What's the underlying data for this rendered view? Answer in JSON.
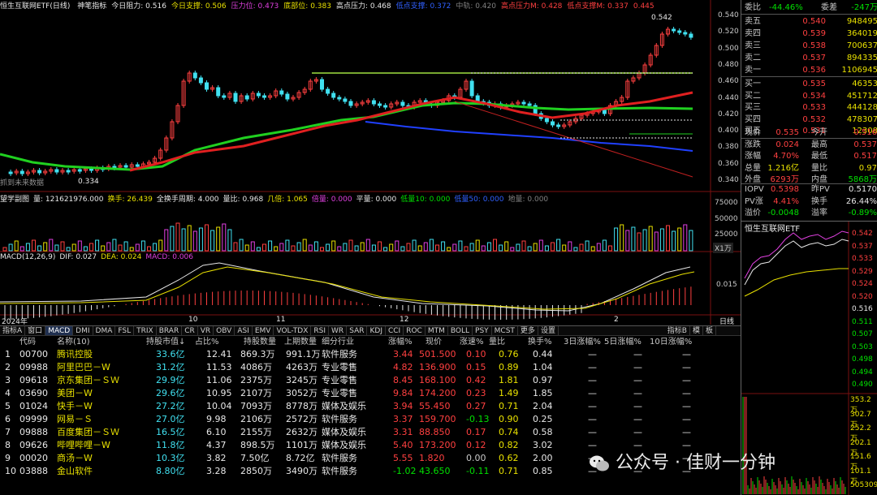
{
  "header": {
    "title": "恒生互联网ETF(日线)",
    "items": [
      {
        "label": "神笔指标",
        "color": "#e8e8e8"
      },
      {
        "label": "今日阻力: 0.516",
        "color": "#e8e8e8"
      },
      {
        "label": "今日支撑: 0.506",
        "color": "#e8e000"
      },
      {
        "label": "压力位: 0.473",
        "color": "#e040e0"
      },
      {
        "label": "底部位: 0.383",
        "color": "#e8e000"
      },
      {
        "label": "高点压力: 0.468",
        "color": "#e8e8e8"
      },
      {
        "label": "低点支撑: 0.372",
        "color": "#3060ff"
      },
      {
        "label": "中轨: 0.420",
        "color": "#808080"
      },
      {
        "label": "高点压力M: 0.428",
        "color": "#ff4040"
      },
      {
        "label": "低点支撑M: 0.337",
        "color": "#ff4040"
      },
      {
        "label": "0.445",
        "color": "#ff4040"
      }
    ]
  },
  "price_axis": [
    "0.540",
    "0.520",
    "0.500",
    "0.480",
    "0.460",
    "0.440",
    "0.420",
    "0.400",
    "0.380",
    "0.360",
    "0.340"
  ],
  "annotations": {
    "high": "0.542",
    "low": "0.334",
    "watermark_note": "抓到未来数据"
  },
  "volume_bar": {
    "items": [
      {
        "label": "望学副图",
        "color": "#e8e8e8"
      },
      {
        "label": "量: 121621976.000",
        "color": "#e8e8e8"
      },
      {
        "label": "换手: 26.439",
        "color": "#e8e000"
      },
      {
        "label": "全换手周期: 4.000",
        "color": "#e8e8e8"
      },
      {
        "label": "量比: 0.968",
        "color": "#e8e8e8"
      },
      {
        "label": "几倍: 1.065",
        "color": "#e8e000"
      },
      {
        "label": "倍量: 0.000",
        "color": "#e040e0"
      },
      {
        "label": "平量: 0.000",
        "color": "#e8e8e8"
      },
      {
        "label": "低量10: 0.000",
        "color": "#00e000"
      },
      {
        "label": "低量50: 0.000",
        "color": "#3060ff"
      },
      {
        "label": "地量: 0.000",
        "color": "#808080"
      }
    ],
    "axis": [
      "75000",
      "50000",
      "25000"
    ],
    "unit": "X1万"
  },
  "macd_bar": {
    "items": [
      {
        "label": "MACD(12,26,9)",
        "color": "#e8e8e8"
      },
      {
        "label": "DIF: 0.027",
        "color": "#e8e8e8"
      },
      {
        "label": "DEA: 0.024",
        "color": "#e8e000"
      },
      {
        "label": "MACD: 0.006",
        "color": "#e040e0"
      }
    ],
    "axis": [
      "0.015"
    ]
  },
  "dates": [
    {
      "label": "2024年",
      "color": "#e8e8e8"
    },
    {
      "label": "10",
      "color": "#e8e8e8"
    },
    {
      "label": "11",
      "color": "#e8e8e8"
    },
    {
      "label": "12",
      "color": "#e8e8e8"
    },
    {
      "label": "2",
      "color": "#e8e8e8"
    }
  ],
  "corner_label": "日线",
  "tabs": [
    "指标A",
    "窗口",
    "MACD",
    "DMI",
    "DMA",
    "FSL",
    "TRIX",
    "BRAR",
    "CR",
    "VR",
    "OBV",
    "ASI",
    "EMV",
    "VOL-TDX",
    "RSI",
    "WR",
    "SAR",
    "KDJ",
    "CCI",
    "ROC",
    "MTM",
    "BOLL",
    "PSY",
    "MCST",
    "更多",
    "设置"
  ],
  "tabs_right": [
    "指标B",
    "模",
    "板"
  ],
  "table": {
    "headers": [
      "代码",
      "名称(10)",
      "持股市值↓",
      "占比%",
      "持股数量",
      "上期数量",
      "细分行业",
      "涨幅%",
      "现价",
      "涨速%",
      "量比",
      "换手%",
      "3日涨幅%",
      "5日涨幅%",
      "10日涨幅%"
    ],
    "rows": [
      {
        "n": "1",
        "code": "00700",
        "name": "腾讯控股",
        "mv": "33.6亿",
        "pct": "12.41",
        "qty": "869.3万",
        "prev": "991.1万",
        "ind": "软件服务",
        "chg": "3.44",
        "px": "501.500",
        "spd": "0.10",
        "vr": "0.76",
        "to": "0.44",
        "d3": "—",
        "d5": "—",
        "d10": "—",
        "chgc": "#ff4040",
        "spdc": "#ff4040"
      },
      {
        "n": "2",
        "code": "09988",
        "name": "阿里巴巴－W",
        "mv": "31.2亿",
        "pct": "11.53",
        "qty": "4086万",
        "prev": "4263万",
        "ind": "专业零售",
        "chg": "4.82",
        "px": "136.900",
        "spd": "0.15",
        "vr": "0.89",
        "to": "1.04",
        "d3": "—",
        "d5": "—",
        "d10": "—",
        "chgc": "#ff4040",
        "spdc": "#ff4040"
      },
      {
        "n": "3",
        "code": "09618",
        "name": "京东集团－ＳＷ",
        "mv": "29.9亿",
        "pct": "11.06",
        "qty": "2375万",
        "prev": "3245万",
        "ind": "专业零售",
        "chg": "8.45",
        "px": "168.100",
        "spd": "0.42",
        "vr": "1.81",
        "to": "0.97",
        "d3": "—",
        "d5": "—",
        "d10": "—",
        "chgc": "#ff4040",
        "spdc": "#ff4040"
      },
      {
        "n": "4",
        "code": "03690",
        "name": "美团－W",
        "mv": "29.6亿",
        "pct": "10.95",
        "qty": "2107万",
        "prev": "3052万",
        "ind": "专业零售",
        "chg": "9.84",
        "px": "174.200",
        "spd": "0.23",
        "vr": "1.49",
        "to": "1.85",
        "d3": "—",
        "d5": "—",
        "d10": "—",
        "chgc": "#ff4040",
        "spdc": "#ff4040"
      },
      {
        "n": "5",
        "code": "01024",
        "name": "快手－W",
        "mv": "27.2亿",
        "pct": "10.04",
        "qty": "7093万",
        "prev": "8778万",
        "ind": "媒体及娱乐",
        "chg": "3.94",
        "px": "55.450",
        "spd": "0.27",
        "vr": "0.71",
        "to": "2.04",
        "d3": "—",
        "d5": "—",
        "d10": "—",
        "chgc": "#ff4040",
        "spdc": "#ff4040"
      },
      {
        "n": "6",
        "code": "09999",
        "name": "网易－Ｓ",
        "mv": "27.0亿",
        "pct": "9.98",
        "qty": "2106万",
        "prev": "2572万",
        "ind": "软件服务",
        "chg": "3.37",
        "px": "159.700",
        "spd": "-0.13",
        "vr": "0.90",
        "to": "0.25",
        "d3": "—",
        "d5": "—",
        "d10": "—",
        "chgc": "#ff4040",
        "spdc": "#00e000"
      },
      {
        "n": "7",
        "code": "09888",
        "name": "百度集团－ＳＷ",
        "mv": "16.5亿",
        "pct": "6.10",
        "qty": "2155万",
        "prev": "2632万",
        "ind": "媒体及娱乐",
        "chg": "3.31",
        "px": "88.850",
        "spd": "0.17",
        "vr": "0.74",
        "to": "0.58",
        "d3": "—",
        "d5": "—",
        "d10": "—",
        "chgc": "#ff4040",
        "spdc": "#ff4040"
      },
      {
        "n": "8",
        "code": "09626",
        "name": "哔哩哔哩－W",
        "mv": "11.8亿",
        "pct": "4.37",
        "qty": "898.5万",
        "prev": "1101万",
        "ind": "媒体及娱乐",
        "chg": "5.40",
        "px": "173.200",
        "spd": "0.12",
        "vr": "0.82",
        "to": "3.02",
        "d3": "—",
        "d5": "—",
        "d10": "—",
        "chgc": "#ff4040",
        "spdc": "#ff4040"
      },
      {
        "n": "9",
        "code": "00020",
        "name": "商汤－W",
        "mv": "10.3亿",
        "pct": "3.82",
        "qty": "7.50亿",
        "prev": "8.72亿",
        "ind": "软件服务",
        "chg": "5.55",
        "px": "1.820",
        "spd": "0.00",
        "vr": "0.62",
        "to": "2.00",
        "d3": "—",
        "d5": "—",
        "d10": "—",
        "chgc": "#ff4040",
        "spdc": "#c8c8c8"
      },
      {
        "n": "10",
        "code": "03888",
        "name": "金山软件",
        "mv": "8.80亿",
        "pct": "3.28",
        "qty": "2850万",
        "prev": "3490万",
        "ind": "软件服务",
        "chg": "-1.02",
        "px": "43.650",
        "spd": "-0.11",
        "vr": "0.71",
        "to": "0.85",
        "d3": "—",
        "d5": "—",
        "d10": "—",
        "chgc": "#00e000",
        "spdc": "#00e000"
      }
    ]
  },
  "quote": {
    "weibi": {
      "label": "委比",
      "value": "-44.46%",
      "label2": "委差",
      "value2": "-247万"
    },
    "asks": [
      {
        "label": "卖五",
        "price": "0.540",
        "vol": "948495"
      },
      {
        "label": "卖四",
        "price": "0.539",
        "vol": "364019"
      },
      {
        "label": "卖三",
        "price": "0.538",
        "vol": "700637"
      },
      {
        "label": "卖二",
        "price": "0.537",
        "vol": "894335"
      },
      {
        "label": "卖一",
        "price": "0.536",
        "vol": "1106945"
      }
    ],
    "bids": [
      {
        "label": "买一",
        "price": "0.535",
        "vol": "46353"
      },
      {
        "label": "买二",
        "price": "0.534",
        "vol": "451712"
      },
      {
        "label": "买三",
        "price": "0.533",
        "vol": "444128"
      },
      {
        "label": "买四",
        "price": "0.532",
        "vol": "478307"
      },
      {
        "label": "买五",
        "price": "0.531",
        "vol": "12308"
      }
    ],
    "stats": [
      {
        "l1": "现价",
        "v1": "0.535",
        "c1": "#ff4040",
        "l2": "今开",
        "v2": "0.516",
        "c2": "#ff4040"
      },
      {
        "l1": "涨跌",
        "v1": "0.024",
        "c1": "#ff4040",
        "l2": "最高",
        "v2": "0.537",
        "c2": "#ff4040"
      },
      {
        "l1": "涨幅",
        "v1": "4.70%",
        "c1": "#ff4040",
        "l2": "最低",
        "v2": "0.517",
        "c2": "#ff4040"
      },
      {
        "l1": "总量",
        "v1": "1.216亿",
        "c1": "#e8e000",
        "l2": "量比",
        "v2": "0.97",
        "c2": "#e8e000"
      },
      {
        "l1": "外盘",
        "v1": "6293万",
        "c1": "#ff4040",
        "l2": "内盘",
        "v2": "5868万",
        "c2": "#00e000"
      }
    ],
    "stats2": [
      {
        "l1": "IOPV",
        "v1": "0.5398",
        "c1": "#ff4040",
        "l2": "昨PV",
        "v2": "0.5170",
        "c2": "#e8e8e8"
      },
      {
        "l1": "PV涨",
        "v1": "4.41%",
        "c1": "#ff4040",
        "l2": "换手",
        "v2": "26.44%",
        "c2": "#e8e8e8"
      },
      {
        "l1": "溢价",
        "v1": "-0.0048",
        "c1": "#00e000",
        "l2": "溢率",
        "v2": "-0.89%",
        "c2": "#00e000"
      }
    ]
  },
  "mini": {
    "title": "恒生互联网ETF",
    "axis": [
      "0.542",
      "0.537",
      "0.533",
      "0.529",
      "0.524",
      "0.520",
      "0.516",
      "0.511",
      "0.507",
      "0.503",
      "0.498",
      "0.494",
      "0.490"
    ],
    "vol_axis": [
      "353.2万",
      "302.7万",
      "252.2万",
      "202.1万",
      "151.6万",
      "101.1万",
      "505309"
    ]
  },
  "watermark": "公众号 · 佳财一分钟",
  "colors": {
    "up": "#ff4040",
    "down": "#00e000",
    "volume_up": "#e8e000",
    "cyan": "#40e0f0"
  }
}
